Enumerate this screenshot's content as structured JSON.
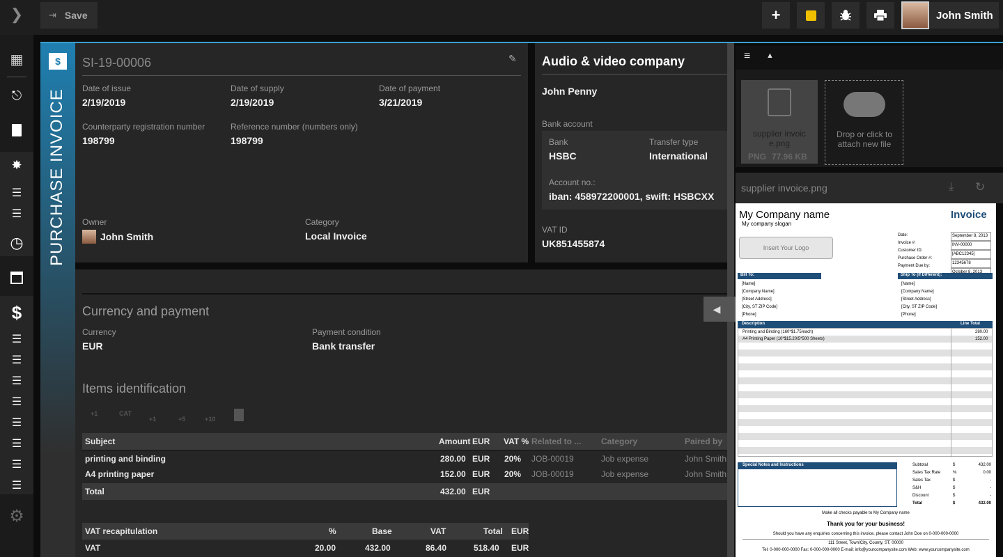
{
  "topbar": {
    "save_label": "Save",
    "user_name": "John Smith"
  },
  "invoice": {
    "vertical_title": "PURCHASE INVOICE",
    "number": "SI-19-00006",
    "fields": [
      {
        "label": "Date of issue",
        "value": "2/19/2019"
      },
      {
        "label": "Date of supply",
        "value": "2/19/2019"
      },
      {
        "label": "Date of payment",
        "value": "3/21/2019"
      },
      {
        "label": "Counterparty registration number",
        "value": "198799"
      },
      {
        "label": "Reference number (numbers only)",
        "value": "198799"
      }
    ],
    "owner_label": "Owner",
    "owner": "John Smith",
    "category_label": "Category",
    "category": "Local Invoice"
  },
  "company": {
    "name": "Audio & video company",
    "contact": "John Penny",
    "bank_account_label": "Bank account",
    "bank_label": "Bank",
    "bank": "HSBC",
    "transfer_label": "Transfer type",
    "transfer": "International",
    "account_label": "Account no.:",
    "account": "iban: 458972200001, swift: HSBCXX",
    "vat_label": "VAT ID",
    "vat": "UK851455874"
  },
  "currency": {
    "title": "Currency and payment",
    "currency_label": "Currency",
    "currency": "EUR",
    "condition_label": "Payment condition",
    "condition": "Bank transfer"
  },
  "items": {
    "title": "Items identification",
    "toolbar": [
      "+1",
      "CAT",
      "+1",
      "+5",
      "+10"
    ],
    "headers": {
      "subject": "Subject",
      "amount": "Amount",
      "cur": "EUR",
      "vat": "VAT %",
      "related": "Related to ...",
      "category": "Category",
      "paired": "Paired by"
    },
    "rows": [
      {
        "subject": "printing and binding",
        "amount": "280.00",
        "cur": "EUR",
        "vat": "20%",
        "related": "JOB-00019",
        "category": "Job expense",
        "paired": "John Smith"
      },
      {
        "subject": "A4 printing paper",
        "amount": "152.00",
        "cur": "EUR",
        "vat": "20%",
        "related": "JOB-00019",
        "category": "Job expense",
        "paired": "John Smith"
      }
    ],
    "total_label": "Total",
    "total": "432.00",
    "total_cur": "EUR"
  },
  "vat_recap": {
    "headers": {
      "name": "VAT recapitulation",
      "pct": "%",
      "base": "Base",
      "vat": "VAT",
      "total": "Total",
      "cur": "EUR"
    },
    "row": {
      "name": "VAT",
      "pct": "20.00",
      "base": "432.00",
      "vat": "86.40",
      "total": "518.40",
      "cur": "EUR"
    }
  },
  "attachments": {
    "file_name": "supplier invoic e.png",
    "file_type": "PNG",
    "file_size": "77.96 KB",
    "drop_text": "Drop or click to attach new file",
    "preview_title": "supplier invoice.png"
  },
  "doc": {
    "company": "My Company name",
    "slogan": "My company slogan",
    "title": "Invoice",
    "logo_btn": "Insert Your Logo",
    "meta_labels": [
      "Date:",
      "Invoice #:",
      "Customer ID:",
      "Purchase Order #:",
      "Payment Due by:"
    ],
    "meta_values": [
      "September 8, 2013",
      "INV-00000",
      "[ABC12345]",
      "12345678",
      "October 8, 2013"
    ],
    "bill_to": "Bill To:",
    "ship_to": "Ship To (If Different):",
    "bill_lines": [
      "[Name]",
      "[Company Name]",
      "[Street Address]",
      "[City, ST  ZIP Code]",
      "[Phone]"
    ],
    "ship_lines": [
      "[Name]",
      "[Company Name]",
      "[Street Address]",
      "[City, ST  ZIP Code]",
      "[Phone]"
    ],
    "desc_header": "Description",
    "line_header": "Line Total",
    "lines": [
      {
        "d": "Printing and Binding (160*$1.75/each)",
        "t": "280.00"
      },
      {
        "d": "A4 Printing Paper (10*$15.20/5*500 Sheets)",
        "t": "152.00"
      }
    ],
    "notes_title": "Special Notes and Instructions",
    "totals": [
      {
        "l": "Subtotal",
        "s": "$",
        "v": "432.00"
      },
      {
        "l": "Sales Tax Rate",
        "s": "%",
        "v": "0.00"
      },
      {
        "l": "Sales Tax",
        "s": "$",
        "v": "-"
      },
      {
        "l": "S&H",
        "s": "$",
        "v": "-"
      },
      {
        "l": "Discount",
        "s": "$",
        "v": "-"
      },
      {
        "l": "Total",
        "s": "$",
        "v": "432.00"
      }
    ],
    "payable": "Make all checks payable to My Company name",
    "thanks": "Thank you for your business!",
    "enquiries": "Should you have any enquiries concerning this invoice, please contact John Doe on 0-000-000-0000",
    "address": "111 Street, Town/City, County, ST, 00000",
    "contact": "Tel: 0-000-000-0000 Fax: 0-000-000-0000 E-mail: info@yourcompanysite.com Web: www.yourcompanysite.com"
  },
  "colors": {
    "accent": "#3aa0d0",
    "doc_blue": "#1f4e79",
    "sticky": "#f0c000"
  }
}
